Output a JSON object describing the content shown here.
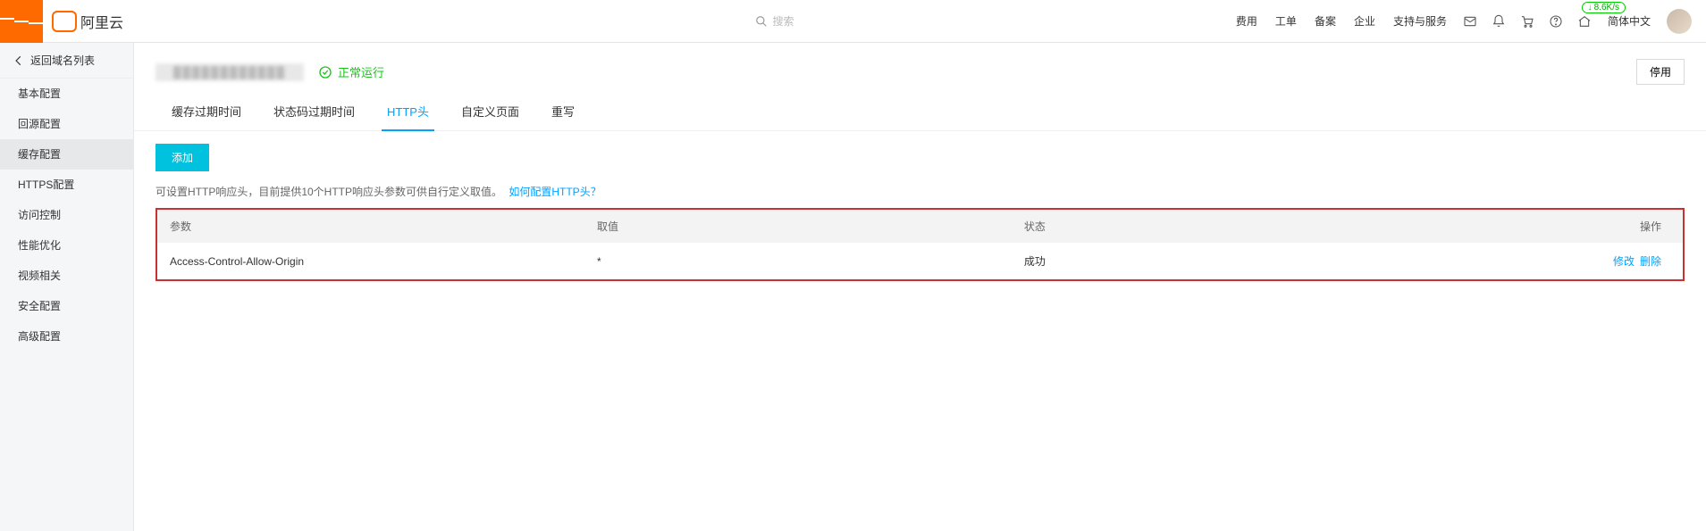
{
  "top": {
    "brand_text": "阿里云",
    "search_placeholder": "搜索",
    "nav": {
      "cost": "费用",
      "ticket": "工单",
      "beian": "备案",
      "enterprise": "企业",
      "support": "支持与服务"
    },
    "speed_badge": "8.6K/s",
    "language": "简体中文"
  },
  "sidebar": {
    "back_label": "返回域名列表",
    "items": [
      "基本配置",
      "回源配置",
      "缓存配置",
      "HTTPS配置",
      "访问控制",
      "性能优化",
      "视频相关",
      "安全配置",
      "高级配置"
    ],
    "active_index": 2
  },
  "page": {
    "domain_masked": "████████████",
    "status_text": "正常运行",
    "disable_btn": "停用"
  },
  "tabs": {
    "items": [
      "缓存过期时间",
      "状态码过期时间",
      "HTTP头",
      "自定义页面",
      "重写"
    ],
    "active_index": 2
  },
  "content": {
    "add_btn": "添加",
    "hint_text": "可设置HTTP响应头，目前提供10个HTTP响应头参数可供自行定义取值。",
    "hint_link": "如何配置HTTP头？",
    "columns": {
      "param": "参数",
      "value": "取值",
      "status": "状态",
      "op": "操作"
    },
    "rows": [
      {
        "param": "Access-Control-Allow-Origin",
        "value": "*",
        "status": "成功"
      }
    ],
    "op_edit": "修改",
    "op_delete": "删除"
  }
}
